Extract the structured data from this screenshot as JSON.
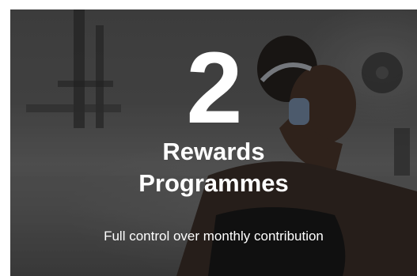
{
  "hero": {
    "number": "2",
    "title": "Rewards\nProgrammes",
    "subtitle": "Full control over monthly contribution"
  },
  "colors": {
    "text": "#ffffff",
    "overlay": "#3e3e3e"
  }
}
